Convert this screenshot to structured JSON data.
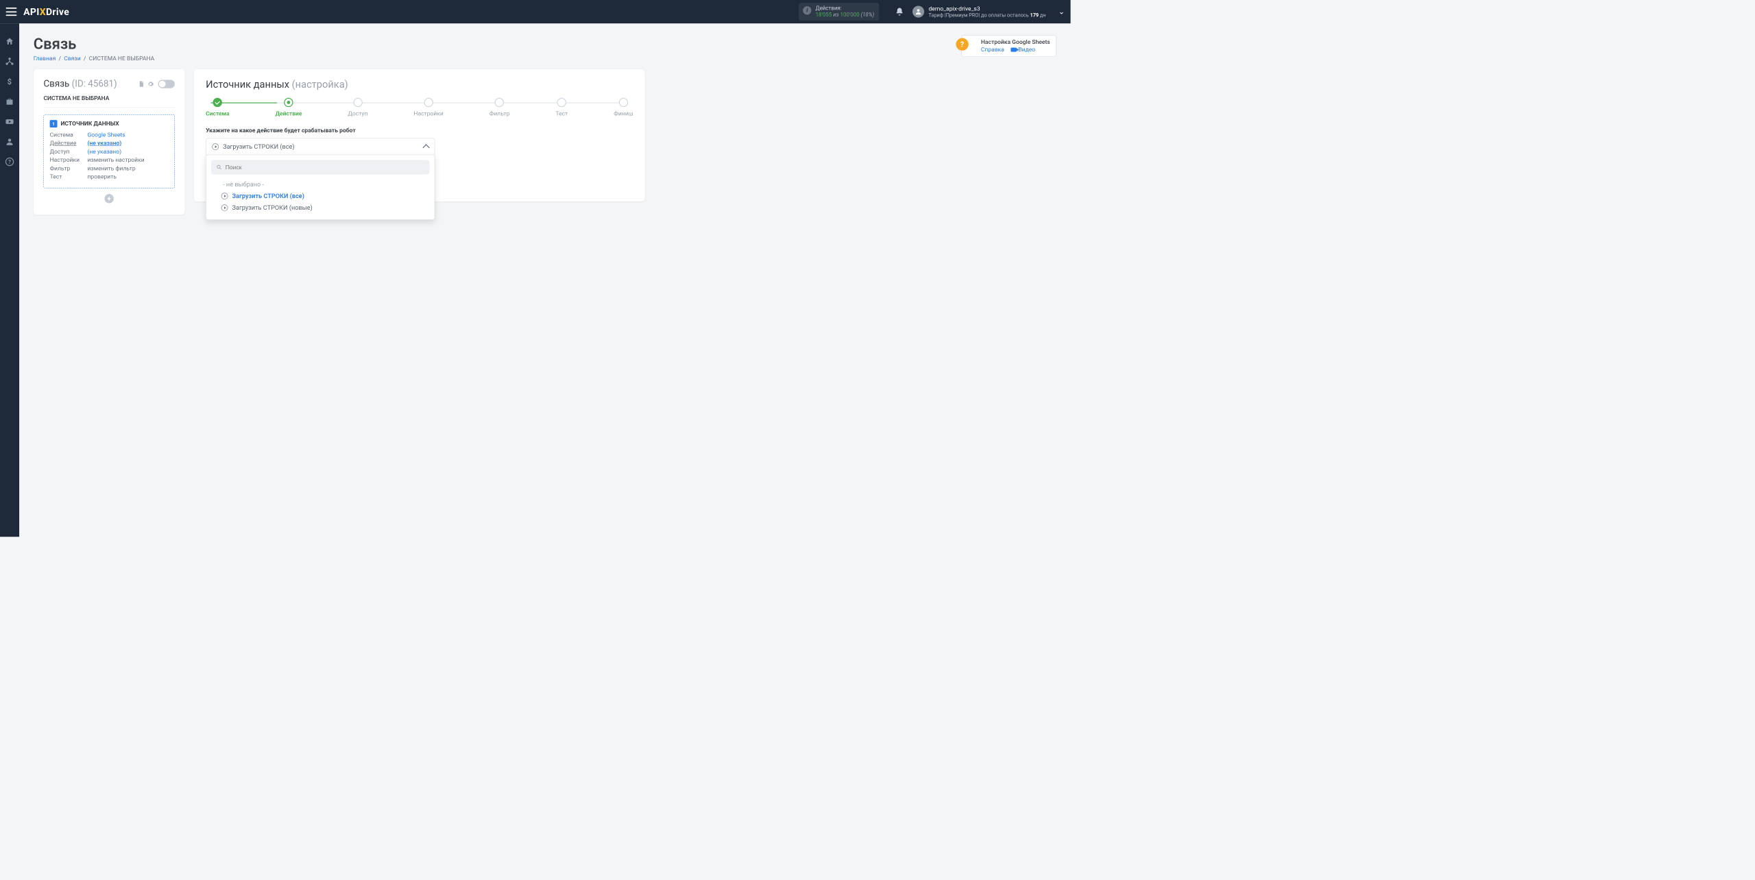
{
  "topbar": {
    "logo_pre": "API",
    "logo_mid": "X",
    "logo_post": "Drive",
    "actions_label": "Действия:",
    "actions_current": "18'055",
    "actions_of": " из ",
    "actions_total": "100'000",
    "actions_pct": " (18%)",
    "user_name": "demo_apix-drive_s3",
    "user_plan_prefix": "Тариф  |Премиум PRO|  до оплаты осталось ",
    "user_plan_days": "179",
    "user_plan_suffix": " дн"
  },
  "page": {
    "title": "Связь",
    "bc_home": "Главная",
    "bc_links": "Связи",
    "bc_current": "СИСТЕМА НЕ ВЫБРАНА",
    "help_title": "Настройка Google Sheets",
    "help_ref": "Справка",
    "help_video": "Видео"
  },
  "left": {
    "title": "Связь ",
    "id_label": "(ID: 45681)",
    "subtitle": "СИСТЕМА НЕ ВЫБРАНА",
    "src_header": "ИСТОЧНИК ДАННЫХ",
    "rows": {
      "system_k": "Система",
      "system_v": "Google Sheets",
      "action_k": "Действие",
      "action_v": "(не указано)",
      "access_k": "Доступ",
      "access_v": "(не указано)",
      "settings_k": "Настройки",
      "settings_v": "изменить настройки",
      "filter_k": "Фильтр",
      "filter_v": "изменить фильтр",
      "test_k": "Тест",
      "test_v": "проверить"
    }
  },
  "right": {
    "title_main": "Источник данных ",
    "title_sub": "(настройка)",
    "steps": [
      "Система",
      "Действие",
      "Доступ",
      "Настройки",
      "Фильтр",
      "Тест",
      "Финиш"
    ],
    "form_label": "Укажите на какое действие будет срабатывать робот",
    "selected": "Загрузить СТРОКИ (все)",
    "search_placeholder": "Поиск",
    "opt_empty": "- не выбрано -",
    "opt_all": "Загрузить СТРОКИ (все)",
    "opt_new": "Загрузить СТРОКИ (новые)"
  }
}
